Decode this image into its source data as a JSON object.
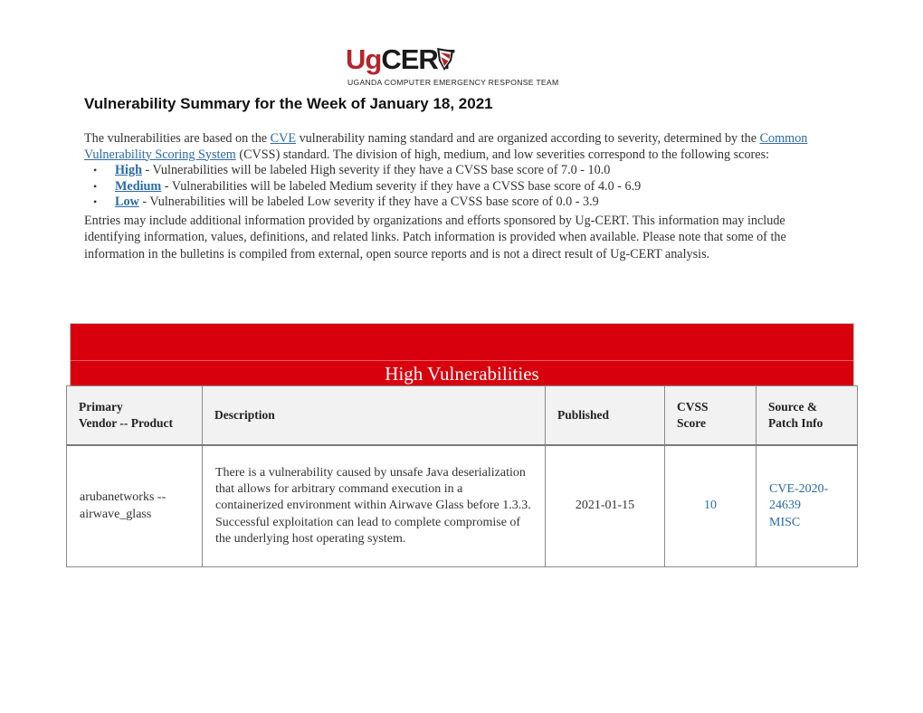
{
  "header": {
    "logo": {
      "prefix": "Ug",
      "suffix": "CERT",
      "icon": "shield-icon",
      "tagline": "UGANDA COMPUTER EMERGENCY RESPONSE TEAM"
    },
    "title": "Vulnerability Summary for the Week of January 18, 2021"
  },
  "intro": {
    "p1_before_cve": "The vulnerabilities are based on the ",
    "cve_link": "CVE",
    "p1_after_cve": " vulnerability naming standard and are organized according to severity, determined by the ",
    "cvss_link": "Common Vulnerability Scoring System",
    "p1_after_cvss": " (CVSS) standard. The division of high, medium, and low severities correspond to the following scores:",
    "severities": [
      {
        "label": "High",
        "text": " - Vulnerabilities will be labeled High severity if they have a CVSS base score of 7.0 - 10.0"
      },
      {
        "label": "Medium",
        "text": " - Vulnerabilities will be labeled Medium severity if they have a CVSS base score of 4.0 - 6.9"
      },
      {
        "label": "Low",
        "text": " - Vulnerabilities will be labeled Low severity if they have a CVSS base score of 0.0 - 3.9"
      }
    ],
    "notes": "Entries may include additional information provided by organizations and efforts sponsored by Ug-CERT. This information may include identifying information, values, definitions, and related links. Patch information is provided when available. Please note that some of the information in the bulletins is compiled from external, open source reports and is not a direct result of Ug-CERT analysis."
  },
  "high_section": {
    "title": "High Vulnerabilities",
    "banner_color": "#d9000d",
    "columns": {
      "vendor_line1": "Primary",
      "vendor_line2": "Vendor -- Product",
      "description": "Description",
      "published": "Published",
      "cvss_line1": "CVSS",
      "cvss_line2": "Score",
      "source_line1": "Source &",
      "source_line2": "Patch Info"
    },
    "rows": [
      {
        "vendor_line1": "arubanetworks --",
        "vendor_line2": "airwave_glass",
        "description": "There is a vulnerability caused by unsafe Java deserialization that allows for arbitrary command execution in a containerized environment within Airwave Glass before 1.3.3. Successful exploitation can lead to complete compromise of the underlying host operating system.",
        "published": "2021-01-15",
        "cvss": "10",
        "source_cve": "CVE-2020-24639",
        "source_misc": "MISC"
      }
    ]
  },
  "colors": {
    "link": "#2a6aa8",
    "logo_red": "#b5252c",
    "header_bg": "#f2f2f2"
  }
}
